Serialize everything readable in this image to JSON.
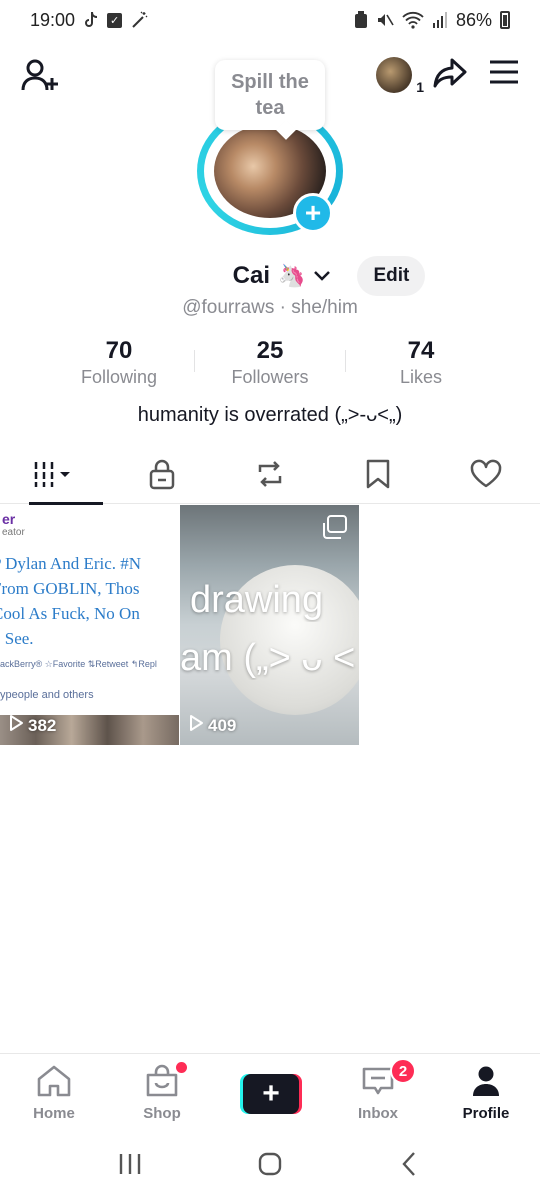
{
  "status_bar": {
    "time": "19:00",
    "battery": "86%",
    "icons": [
      "tiktok-icon",
      "checkbox-icon",
      "magic-wand-icon",
      "recycle-icon",
      "mute-icon",
      "wifi-icon",
      "signal-icon",
      "battery-icon"
    ]
  },
  "header": {
    "tooltip": "Spill the tea",
    "friends_count": "1"
  },
  "profile": {
    "name": "Cai",
    "name_emoji": "🦄",
    "edit_label": "Edit",
    "handle": "@fourraws · she/him",
    "bio": "humanity is overrated („>-ᴗ<„)"
  },
  "stats": [
    {
      "value": "70",
      "label": "Following"
    },
    {
      "value": "25",
      "label": "Followers"
    },
    {
      "value": "74",
      "label": "Likes"
    }
  ],
  "tabs": [
    "videos-grid-icon",
    "lock-icon",
    "repost-icon",
    "bookmark-icon",
    "heart-icon"
  ],
  "videos": [
    {
      "plays": "382",
      "tweet_name": "er",
      "tweet_sub": "eator",
      "tweet_lines": [
        "P Dylan And Eric. #N",
        "From GOBLIN, Thos",
        "Cool As Fuck, No On",
        "o See."
      ],
      "tweet_meta": "ackBerry®   ☆Favorite  ⇅Retweet  ↰Repl",
      "tweet_foot": "ypeople and others"
    },
    {
      "plays": "409",
      "overlay_line1": "drawing",
      "overlay_line2": "am („> ᴗ <"
    }
  ],
  "bottom_nav": {
    "home": "Home",
    "shop": "Shop",
    "inbox": "Inbox",
    "inbox_badge": "2",
    "profile": "Profile"
  },
  "colors": {
    "accent_cyan": "#25f4ee",
    "accent_red": "#fe2c55",
    "ring_blue": "#20b9e8",
    "text_primary": "#161823",
    "text_secondary": "#8a8b91"
  }
}
